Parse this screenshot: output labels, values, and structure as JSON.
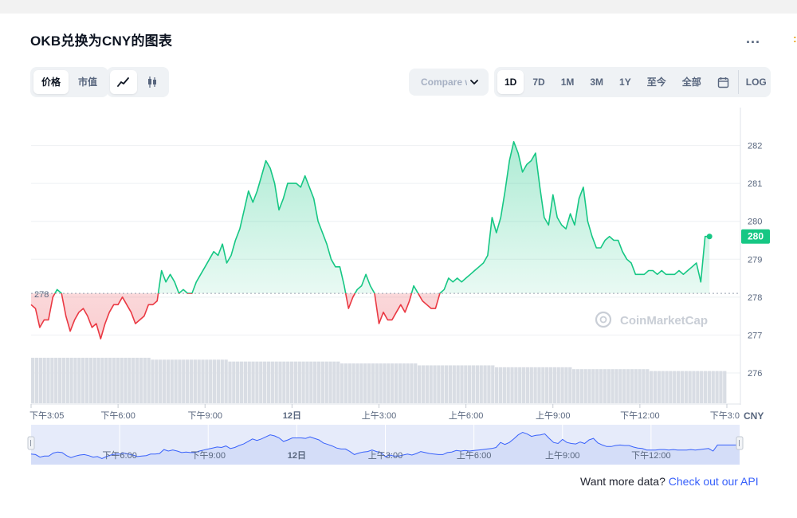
{
  "header": {
    "title": "OKB兑换为CNY的图表",
    "more_label": "..."
  },
  "toolbar": {
    "metric_tabs": [
      {
        "label": "价格",
        "active": true
      },
      {
        "label": "市值",
        "active": false
      }
    ],
    "chart_style": [
      {
        "icon": "line-chart-icon",
        "active": true
      },
      {
        "icon": "candlestick-icon",
        "active": false
      }
    ],
    "compare": {
      "label": "Compare with",
      "icon": "chevron-down-icon"
    },
    "ranges": [
      {
        "label": "1D",
        "active": true
      },
      {
        "label": "7D",
        "active": false
      },
      {
        "label": "1M",
        "active": false
      },
      {
        "label": "3M",
        "active": false
      },
      {
        "label": "1Y",
        "active": false
      },
      {
        "label": "至今",
        "active": false
      },
      {
        "label": "全部",
        "active": false
      }
    ],
    "calendar_icon": "calendar-icon",
    "log_label": "LOG"
  },
  "watermark": "CoinMarketCap",
  "footer": {
    "prefix": "Want more data? ",
    "link": "Check out our API"
  },
  "colors": {
    "up": "#16c784",
    "down": "#ea3943",
    "navigator": "#3861fb",
    "accent": "#3861fb"
  },
  "chart_data": {
    "type": "line",
    "ylabel": "CNY",
    "ylim": [
      275.2,
      283.0
    ],
    "y_ticks": [
      "276",
      "277",
      "278",
      "279",
      "280",
      "281",
      "282"
    ],
    "x_labels": [
      "下午3:05",
      "下午6:00",
      "下午9:00",
      "12日",
      "上午3:00",
      "上午6:00",
      "上午9:00",
      "下午12:00",
      "下午3:0"
    ],
    "x_label_hours": [
      0.0,
      3.0,
      6.0,
      9.0,
      12.0,
      15.0,
      18.0,
      21.0,
      24.0
    ],
    "reference_value": 278.1,
    "reference_label": "278",
    "current_value_label": "280",
    "current_value": 279.6,
    "grid": true,
    "series": [
      {
        "values": [
          [
            0.0,
            277.8
          ],
          [
            0.15,
            277.7
          ],
          [
            0.3,
            277.2
          ],
          [
            0.45,
            277.4
          ],
          [
            0.6,
            277.4
          ],
          [
            0.75,
            278.0
          ],
          [
            0.9,
            278.2
          ],
          [
            1.05,
            278.1
          ],
          [
            1.2,
            277.5
          ],
          [
            1.35,
            277.1
          ],
          [
            1.5,
            277.4
          ],
          [
            1.65,
            277.6
          ],
          [
            1.8,
            277.7
          ],
          [
            1.95,
            277.5
          ],
          [
            2.1,
            277.2
          ],
          [
            2.25,
            277.3
          ],
          [
            2.4,
            276.9
          ],
          [
            2.55,
            277.3
          ],
          [
            2.7,
            277.6
          ],
          [
            2.85,
            277.8
          ],
          [
            3.0,
            277.8
          ],
          [
            3.15,
            278.0
          ],
          [
            3.3,
            277.8
          ],
          [
            3.45,
            277.6
          ],
          [
            3.6,
            277.3
          ],
          [
            3.75,
            277.4
          ],
          [
            3.9,
            277.5
          ],
          [
            4.05,
            277.8
          ],
          [
            4.2,
            277.8
          ],
          [
            4.35,
            277.9
          ],
          [
            4.5,
            278.7
          ],
          [
            4.65,
            278.4
          ],
          [
            4.8,
            278.6
          ],
          [
            4.95,
            278.4
          ],
          [
            5.1,
            278.1
          ],
          [
            5.25,
            278.2
          ],
          [
            5.4,
            278.1
          ],
          [
            5.55,
            278.1
          ],
          [
            5.7,
            278.4
          ],
          [
            5.85,
            278.6
          ],
          [
            6.0,
            278.8
          ],
          [
            6.15,
            279.0
          ],
          [
            6.3,
            279.2
          ],
          [
            6.45,
            279.1
          ],
          [
            6.6,
            279.4
          ],
          [
            6.75,
            278.9
          ],
          [
            6.9,
            279.1
          ],
          [
            7.05,
            279.5
          ],
          [
            7.2,
            279.8
          ],
          [
            7.35,
            280.3
          ],
          [
            7.5,
            280.8
          ],
          [
            7.65,
            280.5
          ],
          [
            7.8,
            280.8
          ],
          [
            7.95,
            281.2
          ],
          [
            8.1,
            281.6
          ],
          [
            8.25,
            281.4
          ],
          [
            8.4,
            281.0
          ],
          [
            8.55,
            280.3
          ],
          [
            8.7,
            280.6
          ],
          [
            8.85,
            281.0
          ],
          [
            9.0,
            281.0
          ],
          [
            9.15,
            281.0
          ],
          [
            9.3,
            280.9
          ],
          [
            9.45,
            281.2
          ],
          [
            9.6,
            280.9
          ],
          [
            9.75,
            280.6
          ],
          [
            9.9,
            280.0
          ],
          [
            10.05,
            279.7
          ],
          [
            10.2,
            279.4
          ],
          [
            10.35,
            279.0
          ],
          [
            10.5,
            278.8
          ],
          [
            10.65,
            278.8
          ],
          [
            10.8,
            278.3
          ],
          [
            10.95,
            277.7
          ],
          [
            11.1,
            278.0
          ],
          [
            11.25,
            278.2
          ],
          [
            11.4,
            278.3
          ],
          [
            11.55,
            278.6
          ],
          [
            11.7,
            278.3
          ],
          [
            11.85,
            278.1
          ],
          [
            12.0,
            277.3
          ],
          [
            12.15,
            277.6
          ],
          [
            12.3,
            277.4
          ],
          [
            12.45,
            277.4
          ],
          [
            12.6,
            277.6
          ],
          [
            12.75,
            277.8
          ],
          [
            12.9,
            277.6
          ],
          [
            13.05,
            277.9
          ],
          [
            13.2,
            278.3
          ],
          [
            13.35,
            278.1
          ],
          [
            13.5,
            277.9
          ],
          [
            13.65,
            277.8
          ],
          [
            13.8,
            277.7
          ],
          [
            13.95,
            277.7
          ],
          [
            14.1,
            278.1
          ],
          [
            14.25,
            278.2
          ],
          [
            14.4,
            278.5
          ],
          [
            14.55,
            278.4
          ],
          [
            14.7,
            278.5
          ],
          [
            14.85,
            278.4
          ],
          [
            15.0,
            278.5
          ],
          [
            15.15,
            278.6
          ],
          [
            15.3,
            278.7
          ],
          [
            15.45,
            278.8
          ],
          [
            15.6,
            278.9
          ],
          [
            15.75,
            279.1
          ],
          [
            15.9,
            280.1
          ],
          [
            16.05,
            279.7
          ],
          [
            16.2,
            280.1
          ],
          [
            16.35,
            280.8
          ],
          [
            16.5,
            281.6
          ],
          [
            16.65,
            282.1
          ],
          [
            16.8,
            281.8
          ],
          [
            16.95,
            281.3
          ],
          [
            17.1,
            281.5
          ],
          [
            17.25,
            281.6
          ],
          [
            17.4,
            281.8
          ],
          [
            17.55,
            280.9
          ],
          [
            17.7,
            280.1
          ],
          [
            17.85,
            279.9
          ],
          [
            18.0,
            280.7
          ],
          [
            18.15,
            280.1
          ],
          [
            18.3,
            279.9
          ],
          [
            18.45,
            279.8
          ],
          [
            18.6,
            280.2
          ],
          [
            18.75,
            279.9
          ],
          [
            18.9,
            280.6
          ],
          [
            19.05,
            280.9
          ],
          [
            19.2,
            280.0
          ],
          [
            19.35,
            279.6
          ],
          [
            19.5,
            279.3
          ],
          [
            19.65,
            279.3
          ],
          [
            19.8,
            279.5
          ],
          [
            19.95,
            279.6
          ],
          [
            20.1,
            279.5
          ],
          [
            20.25,
            279.5
          ],
          [
            20.4,
            279.2
          ],
          [
            20.55,
            279.0
          ],
          [
            20.7,
            278.9
          ],
          [
            20.85,
            278.6
          ],
          [
            21.0,
            278.6
          ],
          [
            21.15,
            278.6
          ],
          [
            21.3,
            278.7
          ],
          [
            21.45,
            278.7
          ],
          [
            21.6,
            278.6
          ],
          [
            21.75,
            278.7
          ],
          [
            21.9,
            278.6
          ],
          [
            22.05,
            278.6
          ],
          [
            22.2,
            278.6
          ],
          [
            22.35,
            278.7
          ],
          [
            22.5,
            278.6
          ],
          [
            22.65,
            278.7
          ],
          [
            22.8,
            278.8
          ],
          [
            22.95,
            278.9
          ],
          [
            23.1,
            278.4
          ],
          [
            23.25,
            279.6
          ],
          [
            23.4,
            279.6
          ]
        ]
      }
    ],
    "volume": [
      276.4,
      276.4,
      276.4,
      276.4,
      276.4,
      276.4,
      276.4,
      276.4,
      276.4,
      276.4,
      276.4,
      276.4,
      276.4,
      276.4,
      276.4,
      276.4,
      276.4,
      276.4,
      276.4,
      276.4,
      276.4,
      276.4,
      276.4,
      276.4,
      276.4,
      276.4,
      276.4,
      276.4,
      276.4,
      276.4,
      276.4,
      276.35,
      276.35,
      276.35,
      276.35,
      276.35,
      276.35,
      276.35,
      276.35,
      276.35,
      276.35,
      276.35,
      276.35,
      276.35,
      276.35,
      276.35,
      276.35,
      276.35,
      276.35,
      276.35,
      276.35,
      276.3,
      276.3,
      276.3,
      276.3,
      276.3,
      276.3,
      276.3,
      276.3,
      276.3,
      276.3,
      276.3,
      276.3,
      276.3,
      276.3,
      276.3,
      276.3,
      276.3,
      276.3,
      276.3,
      276.3,
      276.3,
      276.3,
      276.3,
      276.3,
      276.3,
      276.3,
      276.3,
      276.3,
      276.3,
      276.25,
      276.25,
      276.25,
      276.25,
      276.25,
      276.25,
      276.25,
      276.25,
      276.25,
      276.25,
      276.25,
      276.25,
      276.25,
      276.25,
      276.25,
      276.25,
      276.25,
      276.25,
      276.25,
      276.25,
      276.2,
      276.2,
      276.2,
      276.2,
      276.2,
      276.2,
      276.2,
      276.2,
      276.2,
      276.2,
      276.2,
      276.2,
      276.2,
      276.2,
      276.2,
      276.2,
      276.2,
      276.2,
      276.2,
      276.2,
      276.15,
      276.15,
      276.15,
      276.15,
      276.15,
      276.15,
      276.15,
      276.15,
      276.15,
      276.15,
      276.15,
      276.15,
      276.15,
      276.15,
      276.15,
      276.15,
      276.15,
      276.15,
      276.15,
      276.15,
      276.1,
      276.1,
      276.1,
      276.1,
      276.1,
      276.1,
      276.1,
      276.1,
      276.1,
      276.1,
      276.1,
      276.1,
      276.1,
      276.1,
      276.1,
      276.1,
      276.1,
      276.1,
      276.1,
      276.1,
      276.05,
      276.05,
      276.05,
      276.05,
      276.05,
      276.05,
      276.05,
      276.05,
      276.05,
      276.05,
      276.05,
      276.05,
      276.05,
      276.05,
      276.05,
      276.05,
      276.05,
      276.05,
      276.05,
      276.05
    ],
    "navigator": {
      "x_labels": [
        "下午6:00",
        "下午9:00",
        "12日",
        "上午3:00",
        "上午6:00",
        "上午9:00",
        "下午12:00"
      ]
    }
  }
}
